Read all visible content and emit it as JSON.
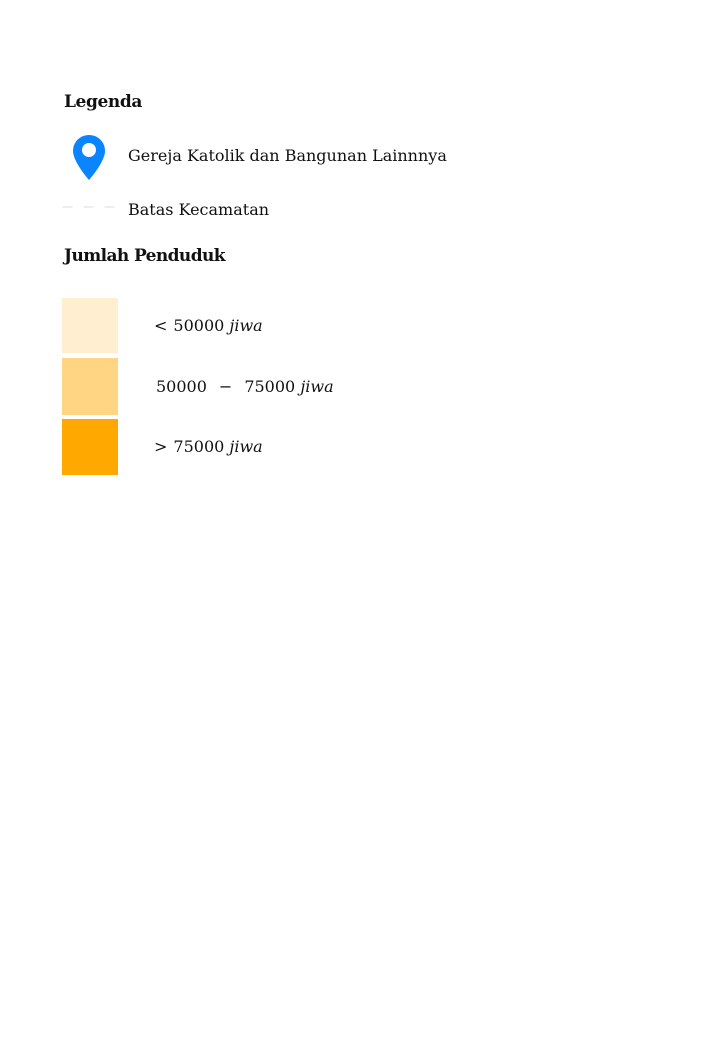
{
  "legend": {
    "title": "Legenda",
    "items": [
      {
        "icon": "map-pin-icon",
        "color": "#0a84ff",
        "label": "Gereja Katolik dan Bangunan  Lainnnya"
      },
      {
        "icon": "dashed-boundary-line",
        "color": "#bdbdbd",
        "label": "Batas Kecamatan"
      }
    ]
  },
  "population": {
    "title": "Jumlah Penduduk",
    "classes": [
      {
        "color": "#ffeecf",
        "operator": "<",
        "value": "50000",
        "unit": "jiwa"
      },
      {
        "color": "#ffd483",
        "from": "50000",
        "dash": "−",
        "to": "75000",
        "unit": "jiwa"
      },
      {
        "color": "#ffa800",
        "operator": ">",
        "value": "75000",
        "unit": "jiwa"
      }
    ]
  }
}
